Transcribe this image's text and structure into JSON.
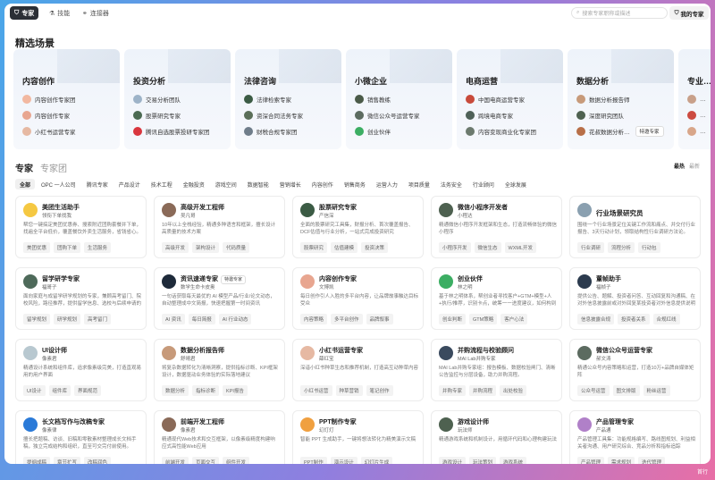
{
  "nav": {
    "tabs": [
      {
        "label": "专家",
        "icon": "expert-icon",
        "active": true
      },
      {
        "label": "技能",
        "icon": "skill-icon",
        "active": false
      },
      {
        "label": "连接器",
        "icon": "connector-icon",
        "active": false
      }
    ],
    "search_placeholder": "搜索专家职称或描述",
    "my_experts": "我的专家"
  },
  "scenes": {
    "title": "精选场景",
    "items": [
      {
        "title": "内容创作",
        "rows": [
          {
            "label": "内容创作专家团",
            "color": "#f2b8a0"
          },
          {
            "label": "内容创作专家",
            "color": "#e8a690"
          },
          {
            "label": "小红书运营专家",
            "color": "#e6b9a3"
          }
        ]
      },
      {
        "title": "投资分析",
        "rows": [
          {
            "label": "交易分析团队",
            "color": "#9db3c8"
          },
          {
            "label": "股票研究专家",
            "color": "#4b6a52"
          },
          {
            "label": "腾讯自选股票投研专家团",
            "color": "#d9363e"
          }
        ]
      },
      {
        "title": "法律咨询",
        "rows": [
          {
            "label": "法律检索专家",
            "color": "#3b5b44"
          },
          {
            "label": "资深合同法务专家",
            "color": "#5a6e58"
          },
          {
            "label": "财税合规专家团",
            "color": "#6f7d8a"
          }
        ]
      },
      {
        "title": "小微企业",
        "rows": [
          {
            "label": "销售教练",
            "color": "#4a5a48"
          },
          {
            "label": "微信公众号运营专家",
            "color": "#5c6b60"
          },
          {
            "label": "创业伙伴",
            "color": "#3cae63"
          }
        ]
      },
      {
        "title": "电商运营",
        "rows": [
          {
            "label": "中国电商运营专家",
            "color": "#c84a3a"
          },
          {
            "label": "跨境电商专家",
            "color": "#4f6158"
          },
          {
            "label": "内容变现商业化专家团",
            "color": "#6c7a6e"
          }
        ]
      },
      {
        "title": "数据分析",
        "rows": [
          {
            "label": "数据分析报告师",
            "color": "#c79a7a"
          },
          {
            "label": "深度研究团队",
            "color": "#4e6150"
          },
          {
            "label": "花叔数据分析…",
            "color": "#b86f48",
            "badge": "特邀专家"
          }
        ]
      },
      {
        "title": "专业…",
        "rows": [
          {
            "label": "…",
            "color": "#c8a08a"
          },
          {
            "label": "…",
            "color": "#cc4a40"
          },
          {
            "label": "…",
            "color": "#d8a68a"
          }
        ]
      }
    ]
  },
  "experts": {
    "title": "专家",
    "team_title": "专家团",
    "sort_hottest": "最热",
    "sort_newest": "最新",
    "filters": [
      "全部",
      "OPC 一人公司",
      "腾讯专家",
      "产品设计",
      "技术工程",
      "金融投资",
      "游戏空间",
      "数据智能",
      "营销增长",
      "内容创作",
      "销售商务",
      "运营人力",
      "项目质量",
      "法务安全",
      "行业顾问",
      "全球发展"
    ],
    "cards": [
      {
        "name": "美团生活助手",
        "author": "领衔下单找我",
        "desc": "帮您一键搞定美团优惠券、搜索附近团购套餐并下单，找遍全平台低价，覆盖餐饮外卖生活服务，省钱省心。",
        "tags": [
          "美团优惠",
          "团购下单",
          "生活服务"
        ],
        "color": "#f5c842"
      },
      {
        "name": "高级开发工程师",
        "author": "吴凡哥",
        "desc": "10年以上全栈经验，精通多种语言和框架，擅长设计高质量的技术方案",
        "tags": [
          "高级开发",
          "架构设计",
          "代码质量"
        ],
        "color": "#8a6a58"
      },
      {
        "name": "股票研究专家",
        "author": "产信深",
        "desc": "全面的股票研究工具集，财报分析、首次覆盖报告、DCF估值与行业分析，一站式完成投资研究",
        "tags": [
          "股票研究",
          "估值建模",
          "投资决策"
        ],
        "color": "#3b5b44"
      },
      {
        "name": "微信小程序开发者",
        "author": "小程达",
        "desc": "精通微信小程序开发框架和生态，打造流畅体验的微信小程序",
        "tags": [
          "小程序开发",
          "微信生态",
          "WXML开发"
        ],
        "color": "#4e6150"
      },
      {
        "name": "行业场景研究员",
        "author": "",
        "desc": "围绕一个行业场景定位关键工作流和痛点、并交付行业报告、3天行动计划，领取结构性行业调研方法论。",
        "tags": [
          "行业调研",
          "流程分析",
          "行动包"
        ],
        "color": "#8aa0b0",
        "single": true
      },
      {
        "name": "留学研学专家",
        "author": "福哥子",
        "desc": "面向家庭与成留学研学规划的专家，兼顾高考留门、院校风险，路径推荐，提供留学信息、选校与后续申请的建议",
        "tags": [
          "留学规划",
          "研学规划",
          "高考留门"
        ],
        "color": "#4e6a5a"
      },
      {
        "name": "资讯速递专家",
        "author": "数学生命卡皮奥",
        "desc": "一句话获取每天最优的 AI 模型产品/行业/论文动态，自动整理成中文简报，快速把握第一时间资讯",
        "tags": [
          "AI 资讯",
          "每日简报",
          "AI 行业动态"
        ],
        "color": "#1e2a3a",
        "badge": "特邀专家"
      },
      {
        "name": "内容创作专家",
        "author": "文博凯",
        "desc": "每日创作引人入胜的多平台内容，让品牌故事触达目标受众",
        "tags": [
          "内容策略",
          "多平台创作",
          "品牌叙事"
        ],
        "color": "#e8a690"
      },
      {
        "name": "创业伙伴",
        "author": "林之明",
        "desc": "基于林之明体系，帮创业者寻找客户+GTM+模型+人+执行/推荐，识别卡点，统筹一一进度建议，如何构到哪些阶段",
        "tags": [
          "创业判断",
          "GTM策略",
          "客户心法"
        ],
        "color": "#3cae63"
      },
      {
        "name": "董帧助手",
        "author": "福帧子",
        "desc": "提供公告、题解、投资者问答、互动回复和沟通稿、在对外信息披露前或对外回复某投资者对外信息提供说明",
        "tags": [
          "信息披露合规",
          "投资者关系",
          "合规红线"
        ],
        "color": "#2c3b4e"
      },
      {
        "name": "UI设计师",
        "author": "像素君",
        "desc": "精通设计系统和组件库，追求像素级完美，打造直观易用的用户界面",
        "tags": [
          "UI设计",
          "组件库",
          "界面规范"
        ],
        "color": "#b8c8d0"
      },
      {
        "name": "数据分析报告师",
        "author": "舒晴君",
        "desc": "将复杂数据转化为清晰洞察，提供指标诊断、KPI框架设计，数据驱动业务体验的实际落地建议",
        "tags": [
          "数据分析",
          "指标诊断",
          "KPI报告"
        ],
        "color": "#c79a7a"
      },
      {
        "name": "小红书运营专家",
        "author": "薛红宝",
        "desc": "深谙小红书种草生态和推荐机制，打造高互动种草内容",
        "tags": [
          "小红书运营",
          "种草营销",
          "笔记创作"
        ],
        "color": "#e6b9a3"
      },
      {
        "name": "并购流程与校验顾问",
        "author": "MAI Lab并购专家",
        "desc": "MAI Lab并购专家组：报告模板、数据校验闸门、清晰公告监控与分层设备，助力并购流程。",
        "tags": [
          "并购专家",
          "并购流程",
          "出处校验"
        ],
        "color": "#3a4a5e"
      },
      {
        "name": "微信公众号运营专家",
        "author": "郝文涛",
        "desc": "精通公众号内容策略和运营，打造10万+品牌自媒体矩阵",
        "tags": [
          "公众号运营",
          "图文排版",
          "粉丝运营"
        ],
        "color": "#5c6b60"
      },
      {
        "name": "长文档写作与改稿专家",
        "author": "像素律",
        "desc": "擅长把题稿、访谈、旧稿和零散素材整理成长文档手稿，独立完成结构和组织，直至可交完付前使用。",
        "tags": [
          "提纲成稿",
          "章节扩写",
          "改稿润色"
        ],
        "color": "#2a7ad8"
      },
      {
        "name": "前端开发工程师",
        "author": "像素君",
        "desc": "精通现代Web技术和交互框架，以像素级精度构建响应式高性能Web应用",
        "tags": [
          "前端开发",
          "页面交互",
          "组件开发"
        ],
        "color": "#8a6a58"
      },
      {
        "name": "PPT制作专家",
        "author": "幻灯灯",
        "desc": "智能 PPT 生成助手，一键将想法转化为精美演示文稿",
        "tags": [
          "PPT制作",
          "演示设计",
          "幻灯片生成"
        ],
        "color": "#f0a040"
      },
      {
        "name": "游戏设计师",
        "author": "玩法师",
        "desc": "精通游戏系统和机制设计，用循环代码和心理构建玩法",
        "tags": [
          "游戏设计",
          "玩法策划",
          "游戏系统"
        ],
        "color": "#4e6150"
      },
      {
        "name": "产品管理专家",
        "author": "产品通",
        "desc": "产品管理工具集：功能规格编写、路线图规划、利益相关者沟通、用户研究综合、竞品分析和指标追踪",
        "tags": [
          "产品管理",
          "需求规划",
          "迭代管理"
        ],
        "color": "#b080c8"
      }
    ]
  },
  "corner_label": "首行"
}
